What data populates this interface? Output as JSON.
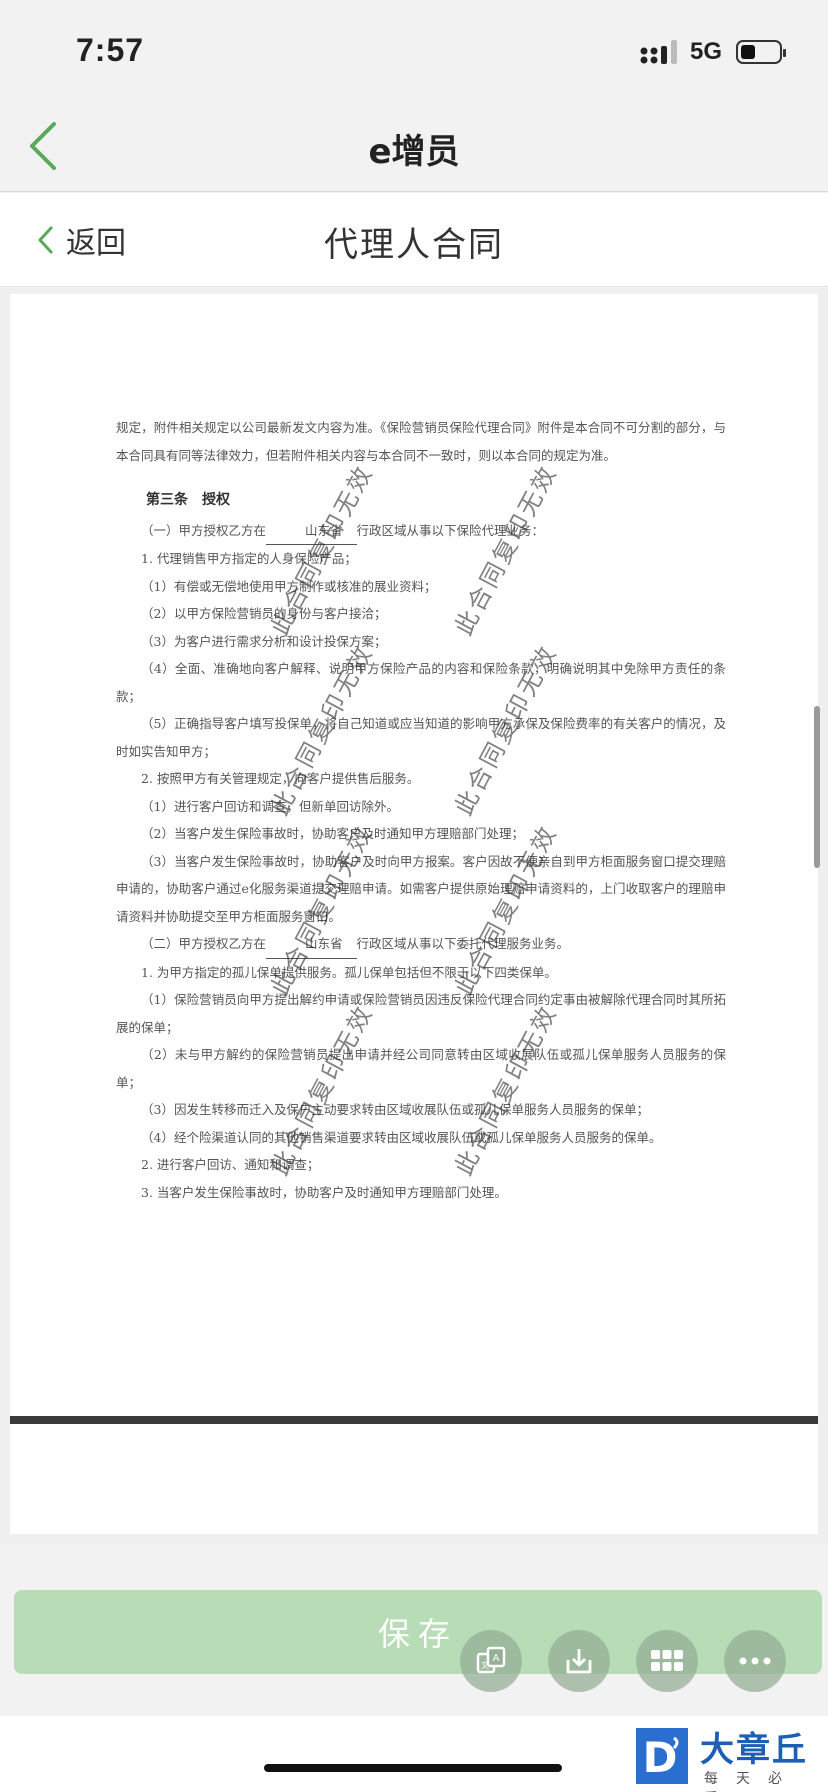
{
  "status_bar": {
    "time": "7:57",
    "network": "5G"
  },
  "nav": {
    "title": "e增员"
  },
  "sub_nav": {
    "back_label": "返回",
    "title": "代理人合同"
  },
  "document": {
    "lines": [
      "规定，附件相关规定以公司最新发文内容为准。《保险营销员保险代理合同》附件是本合同不可分割的部分，与本合同具有同等法律效力，但若附件相关内容与本合同不一致时，则以本合同的规定为准。"
    ],
    "article_heading": "第三条　授权",
    "paragraphs": [
      {
        "pre": "（一）甲方授权乙方在",
        "blank": "山东省",
        "post": "行政区域从事以下保险代理业务："
      },
      {
        "text": "1. 代理销售甲方指定的人身保险产品；"
      },
      {
        "text": "（1）有偿或无偿地使用甲方制作或核准的展业资料；"
      },
      {
        "text": "（2）以甲方保险营销员的身份与客户接洽；"
      },
      {
        "text": "（3）为客户进行需求分析和设计投保方案；"
      },
      {
        "text": "（4）全面、准确地向客户解释、说明甲方保险产品的内容和保险条款，明确说明其中免除甲方责任的条款；"
      },
      {
        "text": "（5）正确指导客户填写投保单，将自己知道或应当知道的影响甲方承保及保险费率的有关客户的情况，及时如实告知甲方；"
      },
      {
        "text": "2. 按照甲方有关管理规定，向客户提供售后服务。"
      },
      {
        "text": "（1）进行客户回访和调查，但新单回访除外。"
      },
      {
        "text": "（2）当客户发生保险事故时，协助客户及时通知甲方理赔部门处理；"
      },
      {
        "text": "（3）当客户发生保险事故时，协助客户及时向甲方报案。客户因故不便亲自到甲方柜面服务窗口提交理赔申请的，协助客户通过e化服务渠道提交理赔申请。如需客户提供原始理赔申请资料的，上门收取客户的理赔申请资料并协助提交至甲方柜面服务窗口。"
      },
      {
        "pre": "（二）甲方授权乙方在",
        "blank": "山东省",
        "post": "行政区域从事以下委托代理服务业务。"
      },
      {
        "text": "1. 为甲方指定的孤儿保单提供服务。孤儿保单包括但不限于以下四类保单。"
      },
      {
        "text": "（1）保险营销员向甲方提出解约申请或保险营销员因违反保险代理合同约定事由被解除代理合同时其所拓展的保单；"
      },
      {
        "text": "（2）未与甲方解约的保险营销员提出申请并经公司同意转由区域收展队伍或孤儿保单服务人员服务的保单；"
      },
      {
        "text": "（3）因发生转移而迁入及保户主动要求转由区域收展队伍或孤儿保单服务人员服务的保单；"
      },
      {
        "text": "（4）经个险渠道认同的其他销售渠道要求转由区域收展队伍或孤儿保单服务人员服务的保单。"
      },
      {
        "text": "2. 进行客户回访、通知和调查；"
      },
      {
        "text": "3. 当客户发生保险事故时，协助客户及时通知甲方理赔部门处理。"
      }
    ],
    "watermark": "此合同复印无效"
  },
  "actions": {
    "save_label": "保存"
  },
  "brand": {
    "name": "大章丘",
    "slogan": "每天必看"
  },
  "colors": {
    "accent_green": "#5aa85a",
    "save_button": "#b7dcb6",
    "brand_blue": "#1d5fb5"
  }
}
